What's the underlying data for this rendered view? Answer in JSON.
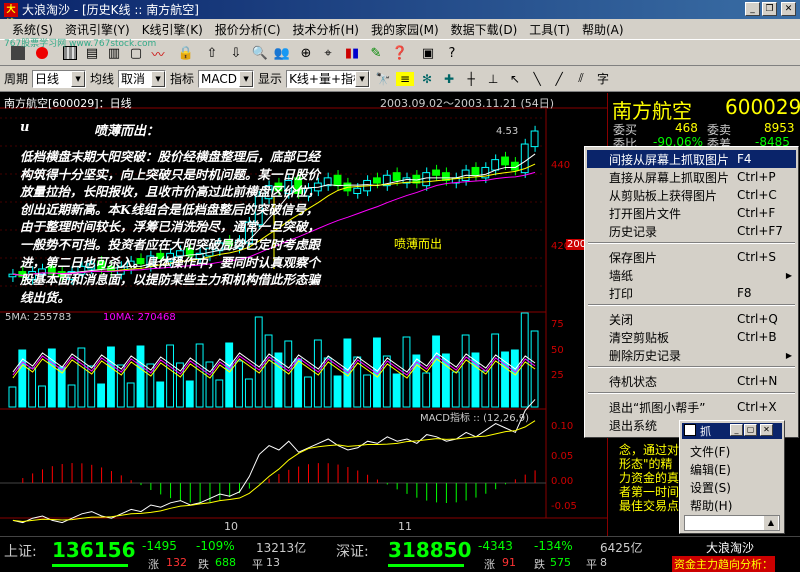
{
  "window": {
    "title": "大浪淘沙 - [历史K线 ::  南方航空]",
    "logo_text": "大浪",
    "min_label": "_",
    "restore_label": "❐",
    "close_label": "✕"
  },
  "menu": [
    "系统(S)",
    "资讯引擎(Y)",
    "K线引擎(K)",
    "报价分析(C)",
    "技术分析(H)",
    "我的家园(M)",
    "数据下载(D)",
    "工具(T)",
    "帮助(A)"
  ],
  "watermark": "767股票学习网 www.767stock.com",
  "toolbar2": {
    "period_label": "周期",
    "period_value": "日线",
    "ma_label": "均线",
    "ma_value": "取消",
    "indicator_label": "指标",
    "indicator_value": "MACD",
    "display_label": "显示",
    "display_value": "K线+量+指标",
    "char_label": "字"
  },
  "chart": {
    "header_name": "南方航空",
    "header_code": "[600029]",
    "header_period": "：日线",
    "range": "2003.09.02～2003.11.21 (54日)",
    "high_label": "4.53",
    "price_ticks": [
      "440",
      "420"
    ],
    "vol_ticks": [
      "75",
      "50",
      "25"
    ],
    "vol_header": "5MA: 255783",
    "vol_header2": "10MA: 270468",
    "macd_header": "MACD指标 :: (12,26,9)",
    "macd_ticks": [
      "0.10",
      "0.05",
      "0.00",
      "-0.05"
    ],
    "date_labels": [
      "10",
      "11"
    ],
    "callout": "喷薄而出",
    "callout_tag": "200"
  },
  "chart_data": {
    "type": "candlestick",
    "title": "南方航空[600029]：日线",
    "range": "2003.09.02～2003.11.21 (54日)",
    "ohlc_trend": [
      3.98,
      3.97,
      3.99,
      4.0,
      3.98,
      3.97,
      3.99,
      4.01,
      4.02,
      4.0,
      3.99,
      4.01,
      4.03,
      4.02,
      4.05,
      4.04,
      4.06,
      4.07,
      4.05,
      4.06,
      4.08,
      4.1,
      4.09,
      4.11,
      4.18,
      4.28,
      4.32,
      4.3,
      4.34,
      4.29,
      4.31,
      4.33,
      4.35,
      4.32,
      4.3,
      4.31,
      4.34,
      4.33,
      4.36,
      4.34,
      4.35,
      4.33,
      4.37,
      4.36,
      4.34,
      4.35,
      4.38,
      4.36,
      4.39,
      4.42,
      4.4,
      4.38,
      4.48,
      4.53
    ],
    "high": 4.53
  },
  "annotation": {
    "u": "u",
    "title": "喷薄而出：",
    "body": "低档横盘末期大阳突破：股价经横盘整理后，底部已经构筑得十分坚实，向上突破只是时机问题。某一日股价放量拉抬，长阳报收，且收市价高过此前横盘区价位，创出近期新高。本K线组合是低档盘整后的突破信号，由于整理时间较长，浮筹已消洗殆尽，通常一旦突破，一般势不可挡。投资者应在大阳突破局势已定时考虑跟进，第二日也可杀入。具体操作中，要同时认真观察个股基本面和消息面，以提防某些主力和机构借此形态骗线出货。"
  },
  "rpanel": {
    "name": "南方航空",
    "code": "600029",
    "buy_label": "委买",
    "buy_value": "468",
    "sell_label": "委卖",
    "sell_value": "8953",
    "ratio_label": "委比",
    "ratio_value": "-90.06%",
    "diff_label": "委差",
    "diff_value": "-8485",
    "side_labels": [
      "开",
      "最",
      "最",
      "收",
      "成",
      "成",
      "涨",
      "换"
    ],
    "bottom_lines": [
      "念，通过对",
      "形态\"的精",
      "力资金的真",
      "者第一时间",
      "最佳交易点"
    ]
  },
  "context_menu": {
    "items": [
      {
        "label": "间接从屏幕上抓取图片",
        "shortcut": "F4",
        "highlighted": true
      },
      {
        "label": "直接从屏幕上抓取图片",
        "shortcut": "Ctrl+P"
      },
      {
        "label": "从剪贴板上获得图片",
        "shortcut": "Ctrl+C"
      },
      {
        "label": "打开图片文件",
        "shortcut": "Ctrl+F"
      },
      {
        "label": "历史记录",
        "shortcut": "Ctrl+F7"
      },
      {
        "sep": true
      },
      {
        "label": "保存图片",
        "shortcut": "Ctrl+S"
      },
      {
        "label": "墙纸",
        "shortcut": "",
        "submenu": true
      },
      {
        "label": "打印",
        "shortcut": "F8"
      },
      {
        "sep": true
      },
      {
        "label": "关闭",
        "shortcut": "Ctrl+Q"
      },
      {
        "label": "清空剪贴板",
        "shortcut": "Ctrl+B"
      },
      {
        "label": "删除历史记录",
        "shortcut": "",
        "submenu": true
      },
      {
        "sep": true
      },
      {
        "label": "待机状态",
        "shortcut": "Ctrl+N"
      },
      {
        "sep": true
      },
      {
        "label": "退出“抓图小帮手”",
        "shortcut": "Ctrl+X"
      },
      {
        "label": "退出系统",
        "shortcut": ""
      }
    ]
  },
  "popup": {
    "title": "抓",
    "items": [
      "文件(F)",
      "编辑(E)",
      "设置(S)",
      "帮助(H)"
    ]
  },
  "status": {
    "sh_label": "上证:",
    "sh_index": "136156",
    "sh_change": "-1495",
    "sh_pct": "-109%",
    "sh_amount": "13213亿",
    "sh_up_label": "涨",
    "sh_up": "132",
    "sh_down_label": "跌",
    "sh_down": "688",
    "sh_flat_label": "平",
    "sh_flat": "13",
    "sz_label": "深证:",
    "sz_index": "318850",
    "sz_change": "-4343",
    "sz_pct": "-134%",
    "sz_amount": "6425亿",
    "sz_up_label": "涨",
    "sz_up": "91",
    "sz_down_label": "跌",
    "sz_down": "575",
    "sz_flat_label": "平",
    "sz_flat": "8",
    "brand": "大浪淘沙",
    "ticker": "资金主力趋向分析："
  },
  "colors": {
    "candle_up": "#00ffff",
    "candle_down": "#00ff00",
    "ma_white": "#ffffff",
    "ma_yellow": "#ffff00",
    "ma_magenta": "#ff00ff"
  }
}
